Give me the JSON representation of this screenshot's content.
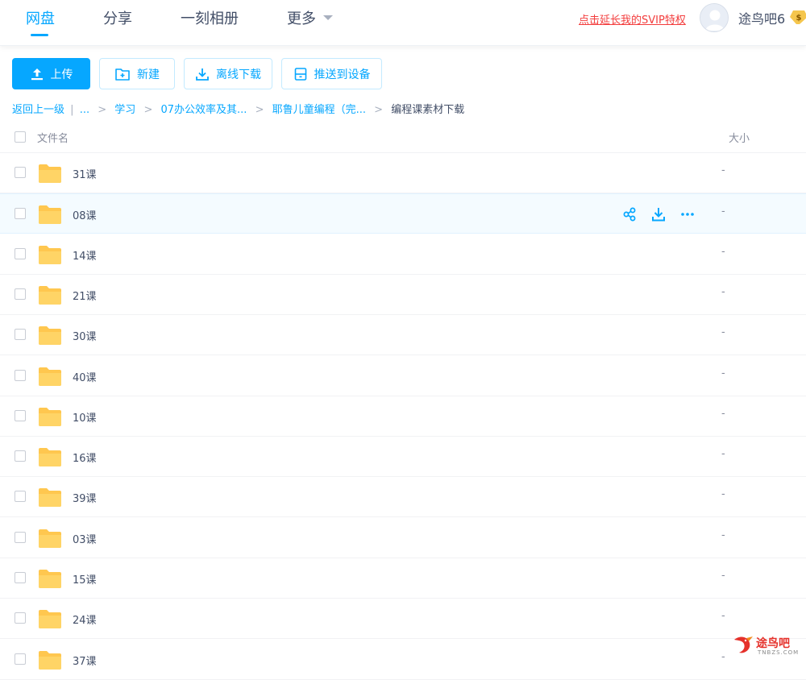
{
  "nav": {
    "tabs": [
      {
        "label": "网盘",
        "active": true
      },
      {
        "label": "分享",
        "active": false
      },
      {
        "label": "一刻相册",
        "active": false
      },
      {
        "label": "更多",
        "active": false
      }
    ],
    "svip_link": "点击延长我的SVIP特权",
    "username": "途鸟吧6",
    "vip_badge_symbol": "$"
  },
  "toolbar": {
    "upload": "上传",
    "new": "新建",
    "offline_download": "离线下载",
    "push_to_device": "推送到设备"
  },
  "breadcrumb": {
    "back": "返回上一级",
    "divider": "|",
    "ellipsis": "...",
    "items": [
      "学习",
      "07办公效率及其...",
      "耶鲁儿童编程（完...",
      "编程课素材下载"
    ],
    "separator": ">"
  },
  "list": {
    "header": {
      "name": "文件名",
      "size": "大小"
    },
    "rows": [
      {
        "name": "31课",
        "size": "-"
      },
      {
        "name": "08课",
        "size": "-",
        "hover": true
      },
      {
        "name": "14课",
        "size": "-"
      },
      {
        "name": "21课",
        "size": "-"
      },
      {
        "name": "30课",
        "size": "-"
      },
      {
        "name": "40课",
        "size": "-"
      },
      {
        "name": "10课",
        "size": "-"
      },
      {
        "name": "16课",
        "size": "-"
      },
      {
        "name": "39课",
        "size": "-"
      },
      {
        "name": "03课",
        "size": "-"
      },
      {
        "name": "15课",
        "size": "-"
      },
      {
        "name": "24课",
        "size": "-"
      },
      {
        "name": "37课",
        "size": "-"
      }
    ],
    "row_action_icons": [
      "share-icon",
      "download-icon",
      "more-icon"
    ]
  },
  "watermark": {
    "text": "途鸟吧",
    "sub": "TNBZS.COM"
  },
  "colors": {
    "accent": "#06a7ff",
    "folder": "#ffc74f",
    "svip_red": "#f33d3d"
  }
}
